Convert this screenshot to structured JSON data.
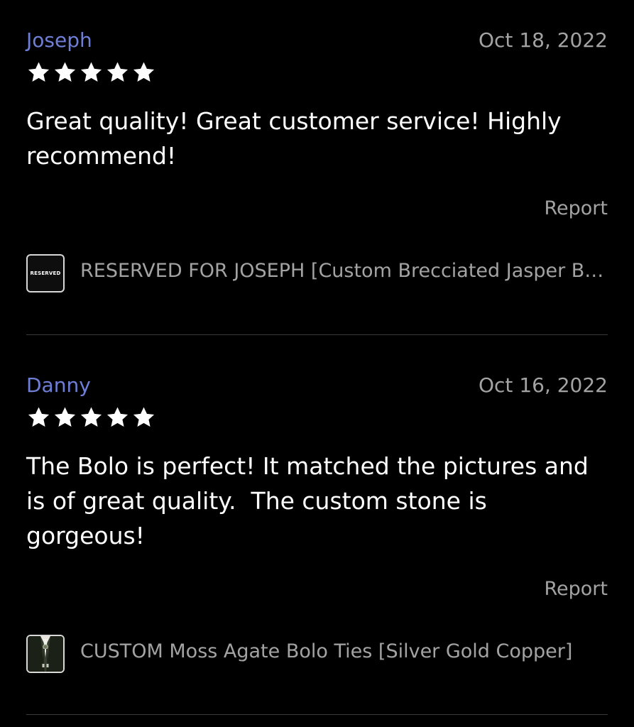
{
  "reviews": [
    {
      "reviewer": "Joseph",
      "date": "Oct 18, 2022",
      "rating": 5,
      "text": "Great quality! Great customer service! Highly recommend!",
      "report_label": "Report",
      "item": {
        "title": "RESERVED FOR JOSEPH [Custom Brecciated Jasper Bolo Tie]",
        "thumb_text": "RESERVED",
        "thumb_icon": "reserved-listing-thumbnail"
      }
    },
    {
      "reviewer": "Danny",
      "date": "Oct 16, 2022",
      "rating": 5,
      "text": "The Bolo is perfect! It matched the pictures and is of great quality.  The custom stone is gorgeous!",
      "report_label": "Report",
      "item": {
        "title": "CUSTOM Moss Agate Bolo Ties [Silver Gold Copper]",
        "thumb_icon": "bolo-tie-photo-thumbnail"
      }
    }
  ],
  "colors": {
    "background": "#000000",
    "reviewer_name": "#6f7fd6",
    "secondary_text": "#a3a3a3",
    "primary_text": "#ffffff",
    "divider": "#3a3a3a"
  }
}
